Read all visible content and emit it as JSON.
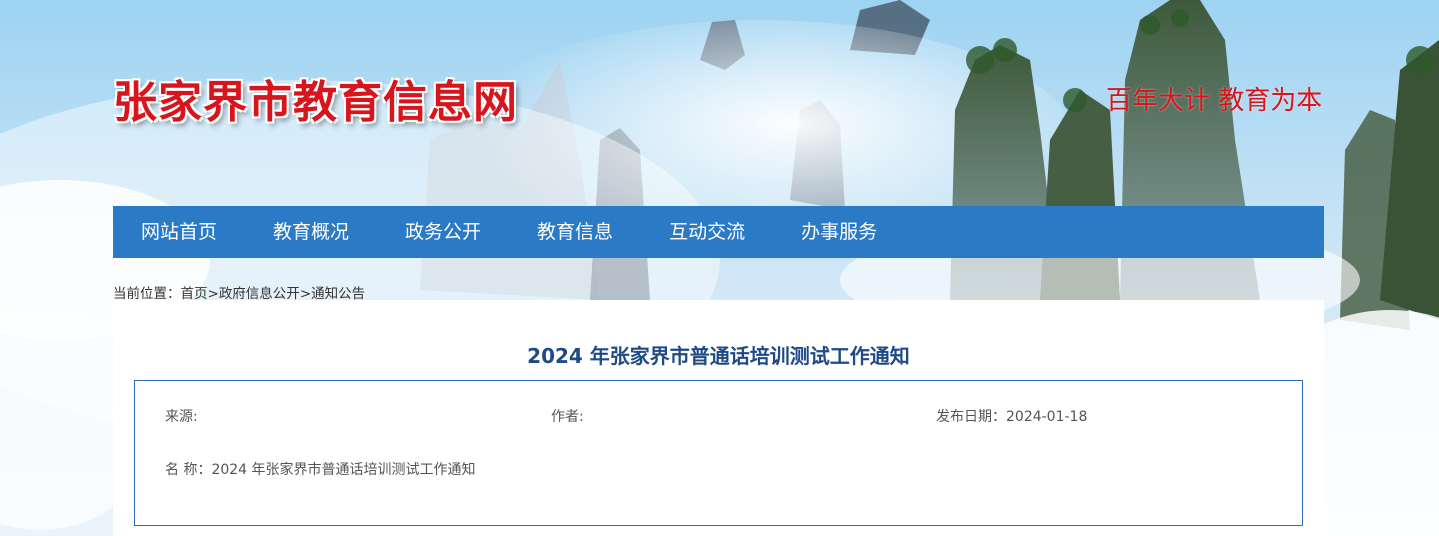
{
  "header": {
    "site_title": "张家界市教育信息网",
    "slogan": "百年大计 教育为本"
  },
  "nav": {
    "items": [
      {
        "label": "网站首页"
      },
      {
        "label": "教育概况"
      },
      {
        "label": "政务公开"
      },
      {
        "label": "教育信息"
      },
      {
        "label": "互动交流"
      },
      {
        "label": "办事服务"
      }
    ]
  },
  "breadcrumb": {
    "prefix": "当前位置：",
    "items": [
      "首页",
      "政府信息公开",
      "通知公告"
    ],
    "separator": ">"
  },
  "article": {
    "title": "2024 年张家界市普通话培训测试工作通知",
    "source_label": "来源:",
    "source_value": "",
    "author_label": "作者:",
    "author_value": "",
    "date_label": "发布日期：",
    "date_value": "2024-01-18",
    "name_label": "名 称：",
    "name_value": "2024 年张家界市普通话培训测试工作通知"
  },
  "colors": {
    "nav_bg": "#2a7ac5",
    "title_red": "#d8141c",
    "article_title": "#1f4a86",
    "box_border": "#2a6bb8"
  }
}
